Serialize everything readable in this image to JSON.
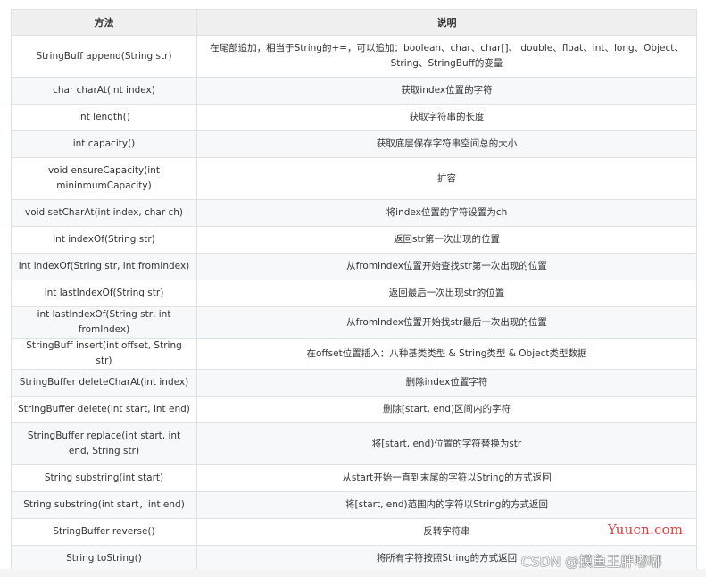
{
  "header": {
    "method": "方法",
    "desc": "说明"
  },
  "rows": [
    {
      "method": "StringBuff append(String str)",
      "desc": "在尾部追加，相当于String的+=，可以追加：boolean、char、char[]、 double、float、int、long、Object、String、StringBuff的变量",
      "tall": true
    },
    {
      "method": "char charAt(int index)",
      "desc": "获取index位置的字符"
    },
    {
      "method": "int length()",
      "desc": "获取字符串的长度"
    },
    {
      "method": "int capacity()",
      "desc": "获取底层保存字符串空间总的大小"
    },
    {
      "method": "void ensureCapacity(int mininmumCapacity)",
      "desc": "扩容",
      "tall": true
    },
    {
      "method": "void setCharAt(int index, char ch)",
      "desc": "将index位置的字符设置为ch"
    },
    {
      "method": "int indexOf(String str)",
      "desc": "返回str第一次出现的位置"
    },
    {
      "method": "int indexOf(String str, int fromIndex)",
      "desc": "从fromIndex位置开始查找str第一次出现的位置"
    },
    {
      "method": "int lastIndexOf(String str)",
      "desc": "返回最后一次出现str的位置"
    },
    {
      "method": "int lastIndexOf(String str, int fromIndex)",
      "desc": "从fromIndex位置开始找str最后一次出现的位置"
    },
    {
      "method": "StringBuff insert(int offset, String str)",
      "desc": "在offset位置插入：八种基类类型 & String类型 & Object类型数据"
    },
    {
      "method": "StringBuffer deleteCharAt(int index)",
      "desc": "删除index位置字符"
    },
    {
      "method": "StringBuffer delete(int start, int end)",
      "desc": "删除[start, end)区间内的字符"
    },
    {
      "method": "StringBuffer replace(int start, int end, String str)",
      "desc": "将[start, end)位置的字符替换为str",
      "tall": true
    },
    {
      "method": "String substring(int start)",
      "desc": "从start开始一直到末尾的字符以String的方式返回"
    },
    {
      "method": "String substring(int start，int end)",
      "desc": "将[start, end)范围内的字符以String的方式返回"
    },
    {
      "method": "StringBuffer reverse()",
      "desc": "反转字符串"
    },
    {
      "method": "String toString()",
      "desc": "将所有字符按照String的方式返回"
    }
  ],
  "watermark": {
    "site": "Yuucn.com",
    "author": "CSDN @摸鱼王胖嘟嘟"
  }
}
